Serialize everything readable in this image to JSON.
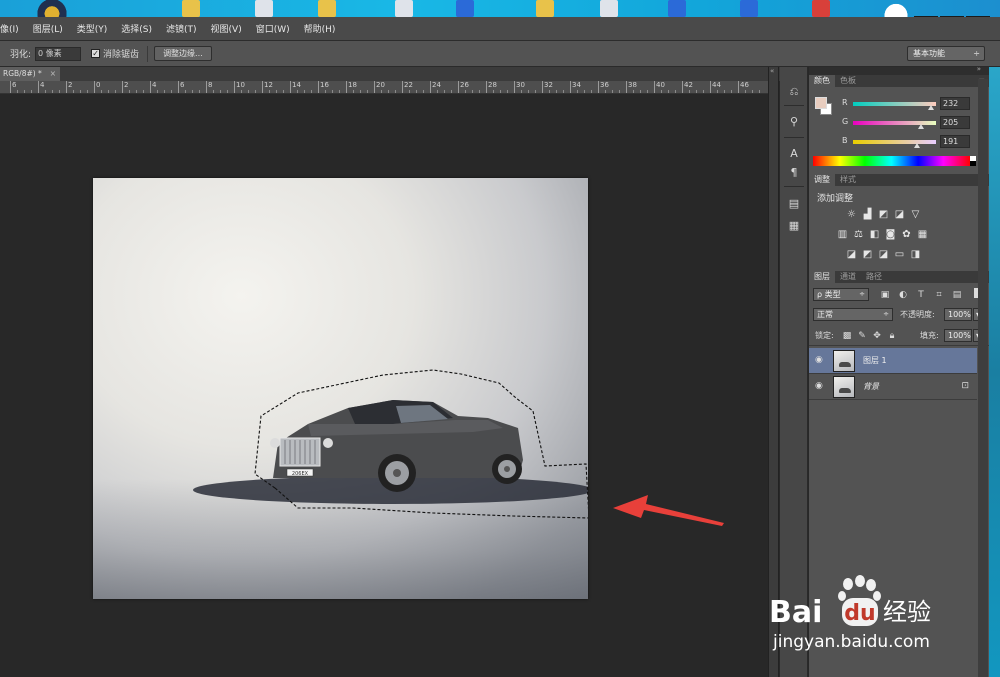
{
  "menu": {
    "items": [
      "像(I)",
      "图层(L)",
      "类型(Y)",
      "选择(S)",
      "滤镜(T)",
      "视图(V)",
      "窗口(W)",
      "帮助(H)"
    ]
  },
  "window_controls": {
    "minimize": "—",
    "maximize": "□",
    "close": "✕"
  },
  "options": {
    "feather_label": "羽化:",
    "feather_value": "0 像素",
    "antialias_label": "消除锯齿",
    "antialias_checked": true,
    "refine_edge_button": "调整边缘...",
    "workspace": "基本功能"
  },
  "document": {
    "tab_label": "RGB/8#) *",
    "tab_close": "×",
    "ruler_labels": [
      "6",
      "4",
      "2",
      "0",
      "2",
      "4",
      "6",
      "8",
      "10",
      "12",
      "14",
      "16",
      "18",
      "20",
      "22",
      "24",
      "26",
      "28",
      "30",
      "32",
      "34",
      "36",
      "38",
      "40",
      "42",
      "44",
      "46"
    ]
  },
  "color_panel": {
    "tabs": [
      "颜色",
      "色板"
    ],
    "foreground": "#e8cdbf",
    "background": "#ffffff",
    "r_label": "R",
    "r_value": "232",
    "g_label": "G",
    "g_value": "205",
    "b_label": "B",
    "b_value": "191"
  },
  "adjustments_panel": {
    "tabs": [
      "调整",
      "样式"
    ],
    "title": "添加调整",
    "icons": [
      "brightness-icon",
      "levels-icon",
      "curves-icon",
      "exposure-icon",
      "vibrance-icon",
      "hue-icon",
      "color-balance-icon",
      "bw-icon",
      "photo-filter-icon",
      "channel-mixer-icon",
      "color-lookup-icon",
      "invert-icon",
      "posterize-icon",
      "threshold-icon",
      "gradient-map-icon",
      "selective-color-icon"
    ]
  },
  "layers_panel": {
    "tabs": [
      "图层",
      "通道",
      "路径"
    ],
    "filter_kind": "ρ 类型",
    "blend_mode": "正常",
    "opacity_label": "不透明度:",
    "opacity_value": "100%",
    "lock_label": "锁定:",
    "fill_label": "填充:",
    "fill_value": "100%",
    "layers": [
      {
        "name": "图层 1",
        "selected": true,
        "locked": false
      },
      {
        "name": "背景",
        "selected": false,
        "locked": true
      }
    ]
  },
  "car": {
    "plate": "206EX"
  },
  "watermark": {
    "brand": "Bai",
    "brand_cn": "经验",
    "url": "jingyan.baidu.com"
  },
  "colors": {
    "arrow": "#e8403a",
    "selected_layer": "#66779a",
    "panel_bg": "#535353",
    "app_bg": "#282828"
  }
}
